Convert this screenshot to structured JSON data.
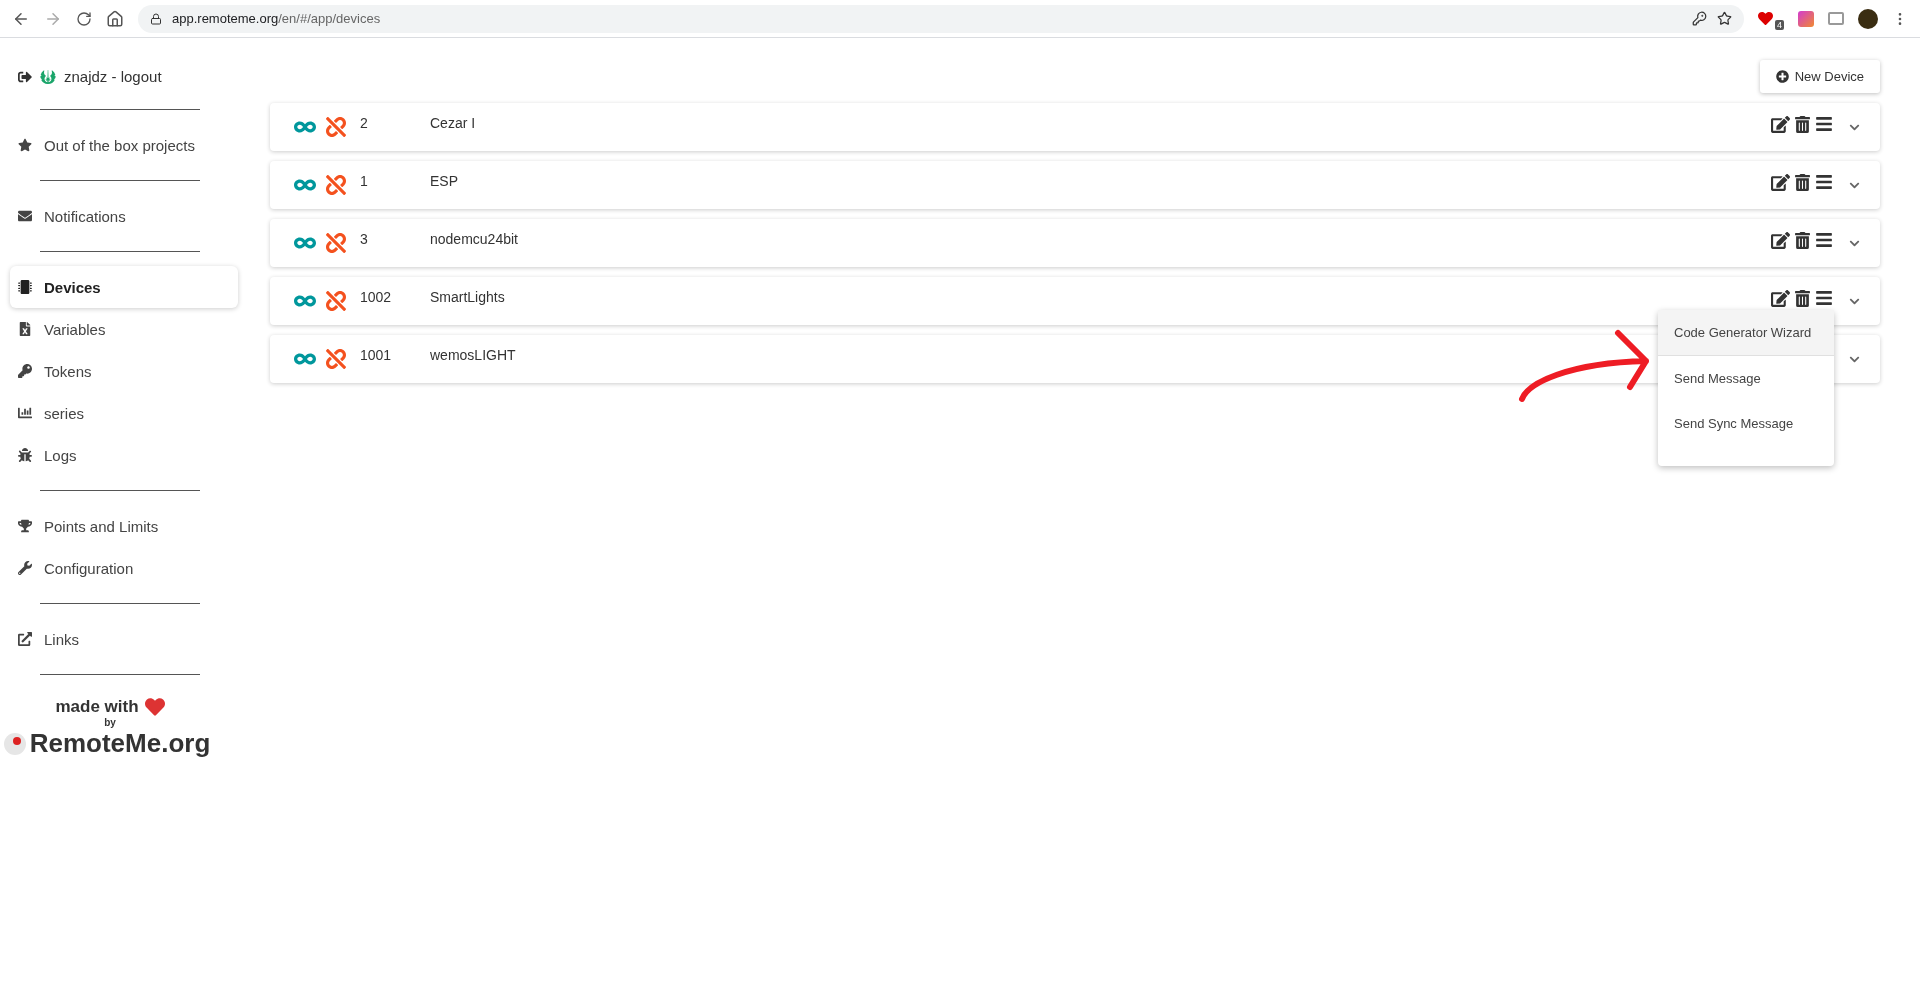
{
  "browser": {
    "url_host": "app.remoteme.org",
    "url_path": "/en/#/app/devices",
    "extension_badge": "4"
  },
  "user": {
    "label": "znajdz - logout"
  },
  "sidebar": {
    "groups": [
      [
        {
          "label": "Out of the box projects",
          "selected": false
        }
      ],
      [
        {
          "label": "Notifications",
          "selected": false
        }
      ],
      [
        {
          "label": "Devices",
          "selected": true
        },
        {
          "label": "Variables",
          "selected": false
        },
        {
          "label": "Tokens",
          "selected": false
        },
        {
          "label": "series",
          "selected": false
        },
        {
          "label": "Logs",
          "selected": false
        }
      ],
      [
        {
          "label": "Points and Limits",
          "selected": false
        },
        {
          "label": "Configuration",
          "selected": false
        }
      ],
      [
        {
          "label": "Links",
          "selected": false
        }
      ]
    ]
  },
  "footer": {
    "made_with": "made with",
    "by": "by",
    "brand": "RemoteMe.org"
  },
  "new_device_button": "New Device",
  "devices": [
    {
      "id": "2",
      "name": "Cezar I"
    },
    {
      "id": "1",
      "name": "ESP"
    },
    {
      "id": "3",
      "name": "nodemcu24bit"
    },
    {
      "id": "1002",
      "name": "SmartLights"
    },
    {
      "id": "1001",
      "name": "wemosLIGHT"
    }
  ],
  "device_menu": {
    "open": true,
    "items": [
      {
        "label": "Code Generator Wizard",
        "selected": true
      },
      {
        "label": "Send Message",
        "selected": false
      },
      {
        "label": "Send Sync Message",
        "selected": false
      }
    ]
  }
}
